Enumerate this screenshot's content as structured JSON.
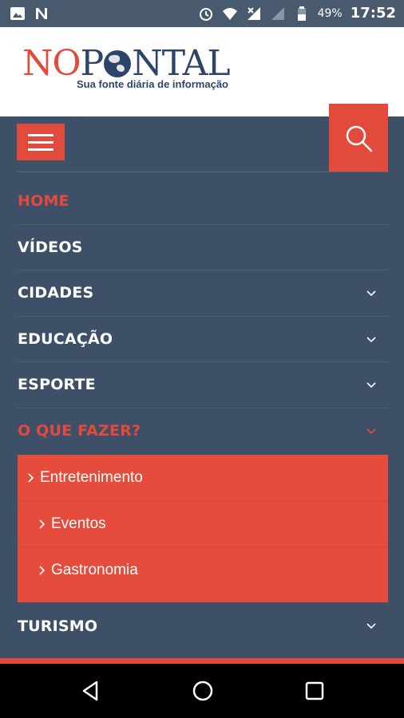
{
  "status_bar": {
    "battery": "49%",
    "time": "17:52",
    "left_icons": [
      "image-icon",
      "n-app-icon"
    ],
    "right_icons": [
      "alarm-icon",
      "wifi-icon",
      "signal-off-icon",
      "signal-icon",
      "battery-icon"
    ]
  },
  "logo": {
    "part1": "NO",
    "part2": "NTAL",
    "part_p": "P",
    "tagline": "Sua fonte diária de informação"
  },
  "nav": {
    "items": [
      {
        "label": "HOME",
        "active": true,
        "has_children": false
      },
      {
        "label": "VÍDEOS",
        "active": false,
        "has_children": false
      },
      {
        "label": "CIDADES",
        "active": false,
        "has_children": true
      },
      {
        "label": "EDUCAÇÃO",
        "active": false,
        "has_children": true
      },
      {
        "label": "ESPORTE",
        "active": false,
        "has_children": true
      },
      {
        "label": "O QUE FAZER?",
        "active": true,
        "has_children": true,
        "expanded": true
      }
    ],
    "submenu": [
      {
        "label": "Entretenimento"
      },
      {
        "label": "Eventos"
      },
      {
        "label": "Gastronomia"
      }
    ],
    "after": {
      "label": "TURISMO",
      "has_children": true
    }
  },
  "colors": {
    "accent": "#e24a3b",
    "nav_bg": "#3e5068",
    "logo_blue": "#2d4569"
  }
}
